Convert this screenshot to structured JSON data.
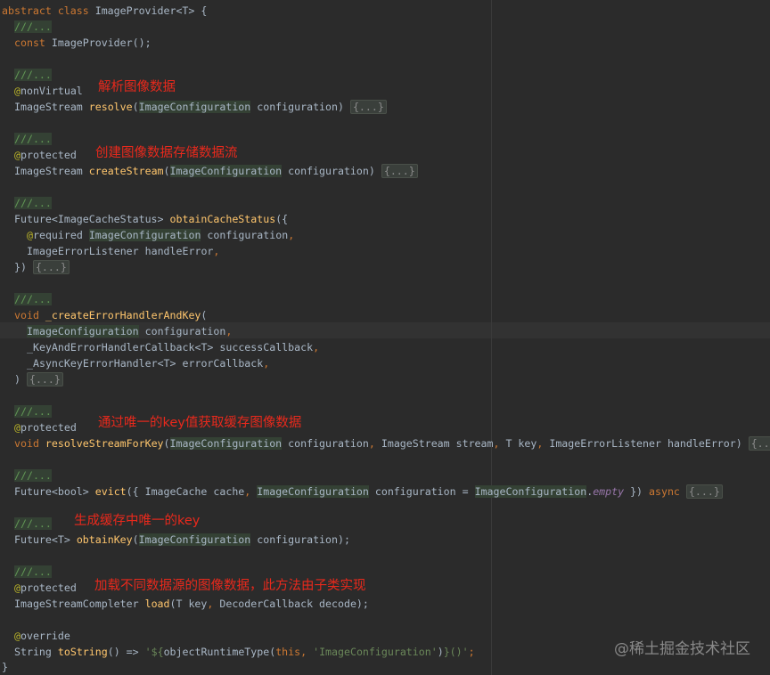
{
  "code": {
    "l01": {
      "kw1": "abstract class",
      "name": " ImageProvider<T> {"
    },
    "l02": {
      "doc": "///..."
    },
    "l03": {
      "kw1": "const",
      "rest": " ImageProvider();"
    },
    "l05": {
      "doc": "///..."
    },
    "l06": {
      "at": "@",
      "ann": "nonVirtual"
    },
    "l07": {
      "t1": "ImageStream ",
      "fn": "resolve",
      "p1": "(",
      "hl": "ImageConfiguration",
      "p2": " configuration) ",
      "fold": "{...}"
    },
    "l09": {
      "doc": "///..."
    },
    "l10": {
      "at": "@",
      "ann": "protected"
    },
    "l11": {
      "t1": "ImageStream ",
      "fn": "createStream",
      "p1": "(",
      "hl": "ImageConfiguration",
      "p2": " configuration) ",
      "fold": "{...}"
    },
    "l13": {
      "doc": "///..."
    },
    "l14": {
      "t1": "Future<ImageCacheStatus> ",
      "fn": "obtainCacheStatus",
      "p1": "({"
    },
    "l15": {
      "at": "@",
      "ann": "required",
      "sp": " ",
      "hl": "ImageConfiguration",
      "p2": " configuration",
      "comma": ","
    },
    "l16": {
      "t1": "ImageErrorListener handleError",
      "comma": ","
    },
    "l17": {
      "t1": "}) ",
      "fold": "{...}"
    },
    "l19": {
      "doc": "///..."
    },
    "l20": {
      "kw1": "void",
      "sp": " ",
      "fn": "_createErrorHandlerAndKey",
      "p1": "("
    },
    "l21": {
      "hl": "ImageConfiguration",
      "p2": " configuration",
      "comma": ","
    },
    "l22": {
      "t1": "_KeyAndErrorHandlerCallback<T> successCallback",
      "comma": ","
    },
    "l23": {
      "t1": "_AsyncKeyErrorHandler<T> errorCallback",
      "comma": ","
    },
    "l24": {
      "t1": ") ",
      "fold": "{...}"
    },
    "l26": {
      "doc": "///..."
    },
    "l27": {
      "at": "@",
      "ann": "protected"
    },
    "l28": {
      "kw1": "void",
      "sp": " ",
      "fn": "resolveStreamForKey",
      "p1": "(",
      "hl": "ImageConfiguration",
      "p2": " configuration",
      "c1": ",",
      "p3": " ImageStream stream",
      "c2": ",",
      "p4": " T key",
      "c3": ",",
      "p5": " ImageErrorListener handleError) ",
      "fold": "{...}"
    },
    "l30": {
      "doc": "///..."
    },
    "l31": {
      "t1": "Future<bool> ",
      "fn": "evict",
      "p1": "({ ImageCache cache",
      "c1": ",",
      "sp": " ",
      "hl": "ImageConfiguration",
      "p2": " configuration = ",
      "hl2": "ImageConfiguration",
      "dot": ".",
      "it": "empty",
      "p3": " }) ",
      "kw2": "async",
      "sp2": " ",
      "fold": "{...}"
    },
    "l33": {
      "doc": "///..."
    },
    "l34": {
      "t1": "Future<T> ",
      "fn": "obtainKey",
      "p1": "(",
      "hl": "ImageConfiguration",
      "p2": " configuration);"
    },
    "l36": {
      "doc": "///..."
    },
    "l37": {
      "at": "@",
      "ann": "protected"
    },
    "l38": {
      "t1": "ImageStreamCompleter ",
      "fn": "load",
      "p1": "(T key",
      "c1": ",",
      "p2": " DecoderCallback decode);"
    },
    "l40": {
      "at": "@",
      "ann": "override"
    },
    "l41": {
      "t1": "String ",
      "fn": "toString",
      "p1": "() => ",
      "s1": "'${",
      "p2": "objectRuntimeType(",
      "kw2": "this",
      "c1": ",",
      "sp": " ",
      "s2": "'ImageConfiguration'",
      "p3": ")",
      "s3": "}()'",
      "semi": ";"
    },
    "l42": {
      "t1": "}"
    }
  },
  "annotations": {
    "resolve": "解析图像数据",
    "create_stream": "创建图像数据存储数据流",
    "resolve_stream_for_key": "通过唯一的key值获取缓存图像数据",
    "obtain_key": "生成缓存中唯一的key",
    "load": "加载不同数据源的图像数据，此方法由子类实现"
  },
  "watermark": "@稀土掘金技术社区",
  "colors": {
    "background": "#2b2b2b",
    "keyword": "#cc7832",
    "function": "#ffc66d",
    "annotation": "#bbb529",
    "doc_comment": "#629755",
    "string": "#6a8759",
    "callout": "#e8291c"
  }
}
